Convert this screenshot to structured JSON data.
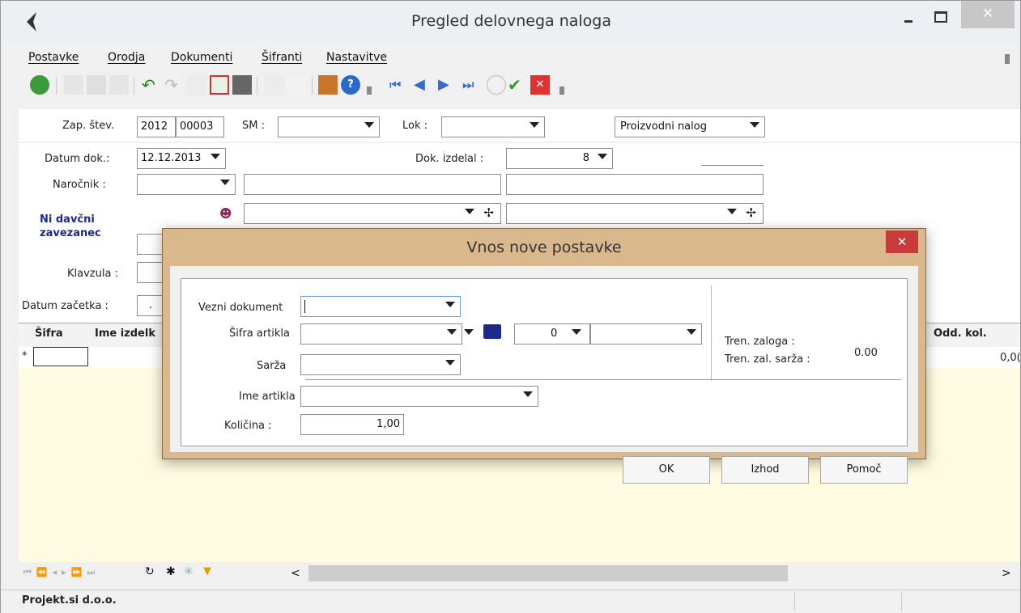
{
  "window": {
    "title": "Pregled delovnega naloga"
  },
  "menu": [
    "Postavke",
    "Orodja",
    "Dokumenti",
    "Šifranti",
    "Nastavitve"
  ],
  "header_row": {
    "zap_label": "Zap. štev.",
    "year": "2012",
    "number": "00003",
    "sm_label": "SM :",
    "lok_label": "Lok :",
    "doc_type": "Proizvodni nalog"
  },
  "form": {
    "datum_label": "Datum dok.:",
    "datum_value": "12.12.2013",
    "izdelal_label": "Dok. izdelal :",
    "izdelal_value": "8",
    "narocnik_label": "Naročnik :",
    "davcni_label": "Ni davčni zavezanec",
    "klavzula_label": "Klavzula :",
    "zacetek_label": "Datum začetka :",
    "zacetek_value": "."
  },
  "grid": {
    "col_sifra": "Šifra",
    "col_ime": "Ime izdelk",
    "col_odd": "Odd. kol.",
    "row_marker": "*",
    "odd_value": "0,0("
  },
  "status": {
    "company": "Projekt.si d.o.o."
  },
  "dialog": {
    "title": "Vnos nove postavke",
    "vezni_label": "Vezni dokument",
    "sifra_label": "Šifra artikla",
    "sarza_label": "Sarža",
    "ime_label": "Ime artikla",
    "kolicina_label": "Količina :",
    "kolicina_value": "1,00",
    "qty_select": "0",
    "tren_zaloga_label": "Tren. zaloga :",
    "tren_sarza_label": "Tren. zal. sarža :",
    "tren_value": "0.00",
    "ok": "OK",
    "izhod": "Izhod",
    "pomoc": "Pomoč"
  }
}
